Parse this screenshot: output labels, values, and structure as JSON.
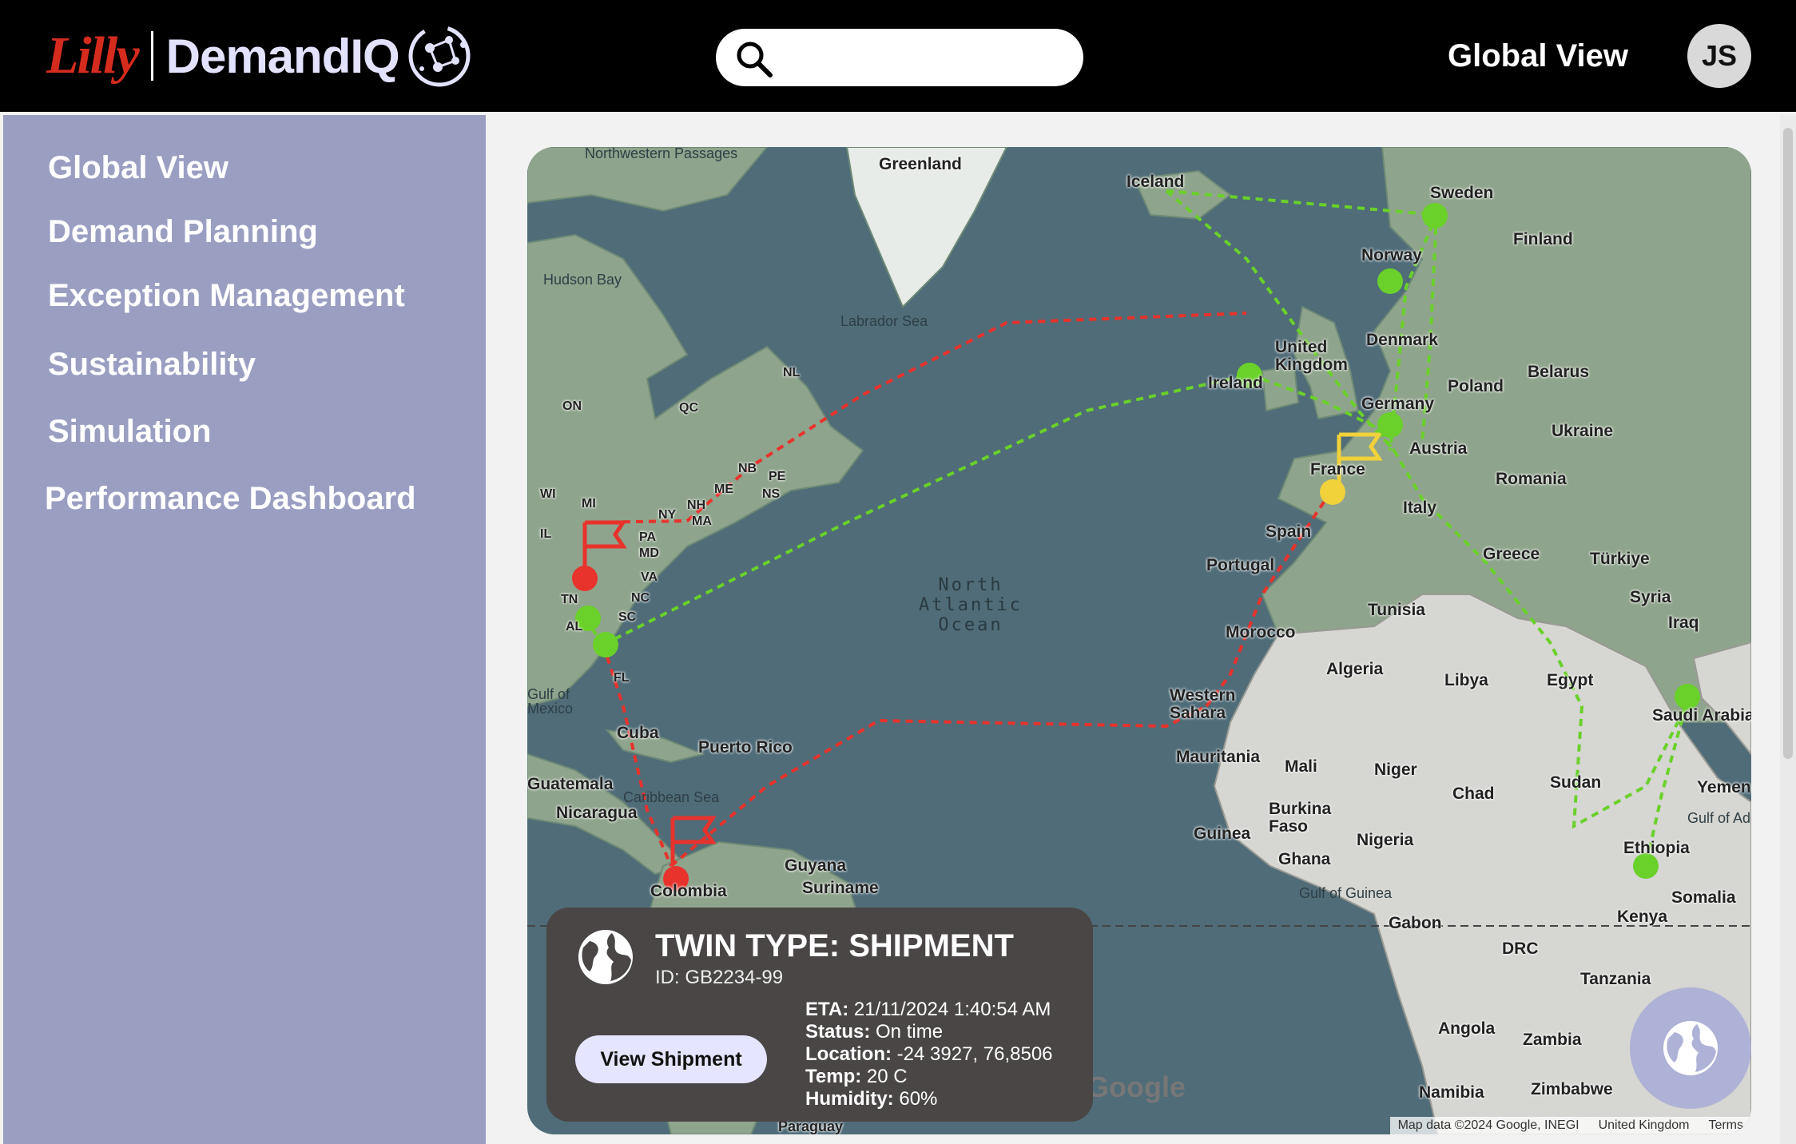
{
  "header": {
    "brand_lilly": "Lilly",
    "brand_product": "DemandIQ",
    "search_placeholder": "",
    "view_title": "Global View",
    "user_initials": "JS"
  },
  "sidebar": {
    "items": [
      {
        "label": "Global View"
      },
      {
        "label": "Demand Planning"
      },
      {
        "label": "Exception Management"
      },
      {
        "label": "Sustainability"
      },
      {
        "label": "Simulation"
      },
      {
        "label": "Performance Dashboard"
      }
    ]
  },
  "map": {
    "labels": {
      "northwestern_passages": "Northwestern Passages",
      "greenland": "Greenland",
      "iceland": "Iceland",
      "sweden": "Sweden",
      "finland": "Finland",
      "norway": "Norway",
      "hudson_bay": "Hudson Bay",
      "labrador_sea": "Labrador Sea",
      "united_kingdom": "United Kingdom",
      "denmark": "Denmark",
      "belarus": "Belarus",
      "poland": "Poland",
      "ireland": "Ireland",
      "germany": "Germany",
      "ukraine": "Ukraine",
      "austria": "Austria",
      "france": "France",
      "romania": "Romania",
      "italy": "Italy",
      "spain": "Spain",
      "portugal": "Portugal",
      "greece": "Greece",
      "turkiye": "Türkiye",
      "syria": "Syria",
      "iraq": "Iraq",
      "tunisia": "Tunisia",
      "morocco": "Morocco",
      "algeria": "Algeria",
      "libya": "Libya",
      "egypt": "Egypt",
      "saudi_arabia": "Saudi Arabia",
      "western_sahara": "Western Sahara",
      "mauritania": "Mauritania",
      "mali": "Mali",
      "niger": "Niger",
      "chad": "Chad",
      "sudan": "Sudan",
      "yemen": "Yemen",
      "gulf_of_aden": "Gulf of Aden",
      "burkina_faso": "Burkina Faso",
      "nigeria": "Nigeria",
      "guinea": "Guinea",
      "ghana": "Ghana",
      "ethiopia": "Ethiopia",
      "gulf_of_guinea": "Gulf of Guinea",
      "somalia": "Somalia",
      "kenya": "Kenya",
      "gabon": "Gabon",
      "drc": "DRC",
      "tanzania": "Tanzania",
      "angola": "Angola",
      "zambia": "Zambia",
      "namibia": "Namibia",
      "zimbabwe": "Zimbabwe",
      "on": "ON",
      "qc": "QC",
      "nl": "NL",
      "nb": "NB",
      "pe": "PE",
      "me": "ME",
      "ns": "NS",
      "wi": "WI",
      "mi": "MI",
      "nh": "NH",
      "ny": "NY",
      "ma": "MA",
      "il": "IL",
      "pa": "PA",
      "md": "MD",
      "va": "VA",
      "nc": "NC",
      "tn": "TN",
      "sc": "SC",
      "al": "AL",
      "fl": "FL",
      "gulf_of_mexico": "Gulf of Mexico",
      "cuba": "Cuba",
      "puerto_rico": "Puerto Rico",
      "guatemala": "Guatemala",
      "caribbean_sea": "Caribbean Sea",
      "nicaragua": "Nicaragua",
      "guyana": "Guyana",
      "suriname": "Suriname",
      "colombia": "Colombia",
      "paraguay": "Paraguay",
      "ocean": "North\nAtlantic\nOcean"
    },
    "google_logo": "Google",
    "attribution": {
      "data": "Map data ©2024 Google, INEGI",
      "region": "United Kingdom",
      "terms": "Terms"
    },
    "colors": {
      "delayed": "#e8322c",
      "warning": "#f1d23a",
      "on_time": "#6ad12a"
    }
  },
  "card": {
    "title": "TWIN TYPE: SHIPMENT",
    "id": "ID: GB2234-99",
    "eta_label": "ETA:",
    "eta_value": "21/11/2024 1:40:54 AM",
    "status_label": "Status:",
    "status_value": "On time",
    "location_label": "Location:",
    "location_value": "-24 3927, 76,8506",
    "temp_label": "Temp:",
    "temp_value": "20 C",
    "humidity_label": "Humidity:",
    "humidity_value": "60%",
    "button_label": "View Shipment"
  }
}
